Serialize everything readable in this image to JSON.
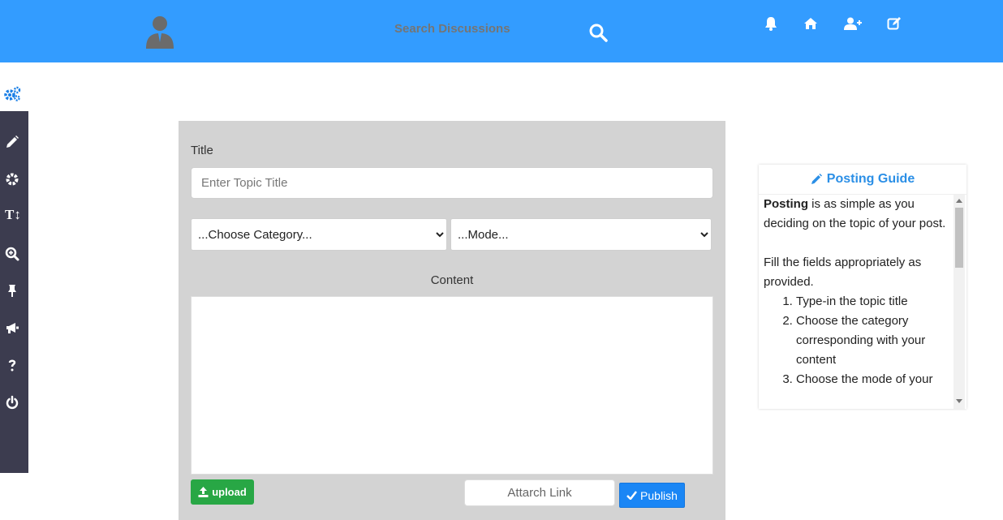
{
  "header": {
    "search_placeholder": "Search Discussions",
    "icons": [
      "bell-icon",
      "home-icon",
      "add-user-icon",
      "edit-icon"
    ],
    "avatar_icon": "user-avatar-icon",
    "search_icon": "search-icon"
  },
  "colors": {
    "topbar": "#339cff",
    "sidebar": "#3c3c4f",
    "panel": "#d3d3d3",
    "upload": "#28a745",
    "publish": "#1a86f5",
    "guide_accent": "#2b8fe6"
  },
  "sidebar": {
    "top_icon": "settings-cluster-icon",
    "items": [
      {
        "name": "pencil-icon"
      },
      {
        "name": "gear-icon"
      },
      {
        "name": "text-size-icon",
        "text": "T↕"
      },
      {
        "name": "zoom-icon"
      },
      {
        "name": "pin-icon"
      },
      {
        "name": "megaphone-icon"
      },
      {
        "name": "question-icon"
      },
      {
        "name": "power-icon"
      }
    ]
  },
  "form": {
    "title_label": "Title",
    "title_placeholder": "Enter Topic Title",
    "category_selected": "...Choose Category...",
    "mode_selected": "...Mode...",
    "content_label": "Content",
    "upload_label": "upload",
    "attach_placeholder": "Attarch Link",
    "publish_label": "Publish"
  },
  "guide": {
    "header": "Posting Guide",
    "intro_bold": "Posting",
    "intro_rest": " is as simple as you deciding on the topic of your post.",
    "instruction": "Fill the fields appropriately as provided.",
    "steps": [
      "Type-in the topic title",
      "Choose the category corresponding with your content",
      "Choose the mode of your"
    ]
  }
}
